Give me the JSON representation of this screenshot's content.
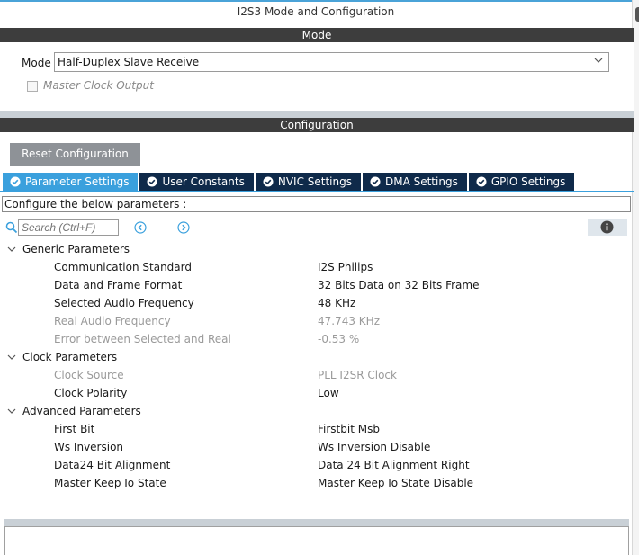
{
  "window": {
    "title": "I2S3 Mode and Configuration"
  },
  "mode_section": {
    "header": "Mode",
    "mode_label": "Mode",
    "mode_value": "Half-Duplex Slave Receive",
    "master_clock_output_label": "Master Clock Output",
    "master_clock_output_checked": false
  },
  "config_section": {
    "header": "Configuration",
    "reset_button": "Reset Configuration"
  },
  "tabs": [
    {
      "label": "Parameter Settings",
      "active": true
    },
    {
      "label": "User Constants",
      "active": false
    },
    {
      "label": "NVIC Settings",
      "active": false
    },
    {
      "label": "DMA Settings",
      "active": false
    },
    {
      "label": "GPIO Settings",
      "active": false
    }
  ],
  "param_hint": "Configure the below parameters :",
  "search": {
    "placeholder": "Search (Ctrl+F)"
  },
  "groups": [
    {
      "label": "Generic Parameters",
      "params": [
        {
          "name": "Communication Standard",
          "value": "I2S Philips",
          "enabled": true
        },
        {
          "name": "Data and Frame Format",
          "value": "32 Bits Data on 32 Bits Frame",
          "enabled": true
        },
        {
          "name": "Selected Audio Frequency",
          "value": "48 KHz",
          "enabled": true
        },
        {
          "name": "Real Audio Frequency",
          "value": "47.743 KHz",
          "enabled": false
        },
        {
          "name": "Error between Selected and Real",
          "value": "-0.53 %",
          "enabled": false
        }
      ]
    },
    {
      "label": "Clock Parameters",
      "params": [
        {
          "name": "Clock Source",
          "value": "PLL I2SR Clock",
          "enabled": false
        },
        {
          "name": "Clock Polarity",
          "value": "Low",
          "enabled": true
        }
      ]
    },
    {
      "label": "Advanced Parameters",
      "params": [
        {
          "name": "First Bit",
          "value": "Firstbit Msb",
          "enabled": true
        },
        {
          "name": "Ws Inversion",
          "value": "Ws Inversion Disable",
          "enabled": true
        },
        {
          "name": "Data24 Bit Alignment",
          "value": "Data 24 Bit Alignment Right",
          "enabled": true
        },
        {
          "name": "Master Keep Io State",
          "value": "Master Keep Io State Disable",
          "enabled": true
        }
      ]
    }
  ],
  "colors": {
    "section_bar": "#3d3d3d",
    "tab_active": "#3aa0dd",
    "tab_inactive": "#0f2a4a",
    "reset_button": "#8e9297",
    "disabled_text": "#9a9a9a"
  }
}
